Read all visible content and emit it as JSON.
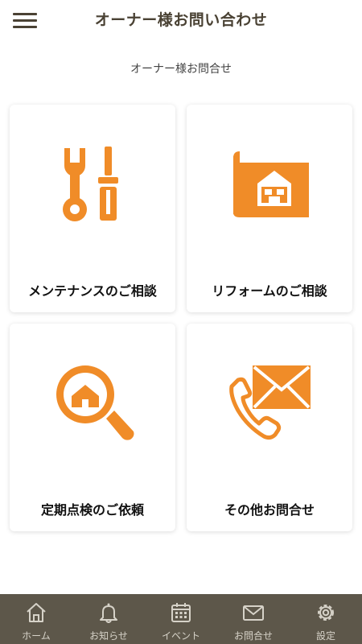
{
  "header": {
    "title": "オーナー様お問い合わせ",
    "menu_icon": "hamburger-menu-icon"
  },
  "page": {
    "subtitle": "オーナー様お問合せ"
  },
  "colors": {
    "accent": "#f08c28",
    "header_text": "#4a4234",
    "nav_background": "#5d574a",
    "nav_text": "#d6d2c8"
  },
  "cards": [
    {
      "label": "メンテナンスのご相談",
      "icon": "wrench-screwdriver-icon"
    },
    {
      "label": "リフォームのご相談",
      "icon": "house-blueprint-icon"
    },
    {
      "label": "定期点検のご依頼",
      "icon": "magnifier-house-icon"
    },
    {
      "label": "その他お問合せ",
      "icon": "phone-mail-icon"
    }
  ],
  "nav": {
    "items": [
      {
        "label": "ホーム",
        "icon": "home-icon"
      },
      {
        "label": "お知らせ",
        "icon": "bell-icon"
      },
      {
        "label": "イベント",
        "icon": "calendar-icon"
      },
      {
        "label": "お問合せ",
        "icon": "envelope-icon"
      },
      {
        "label": "設定",
        "icon": "gear-icon"
      }
    ]
  }
}
